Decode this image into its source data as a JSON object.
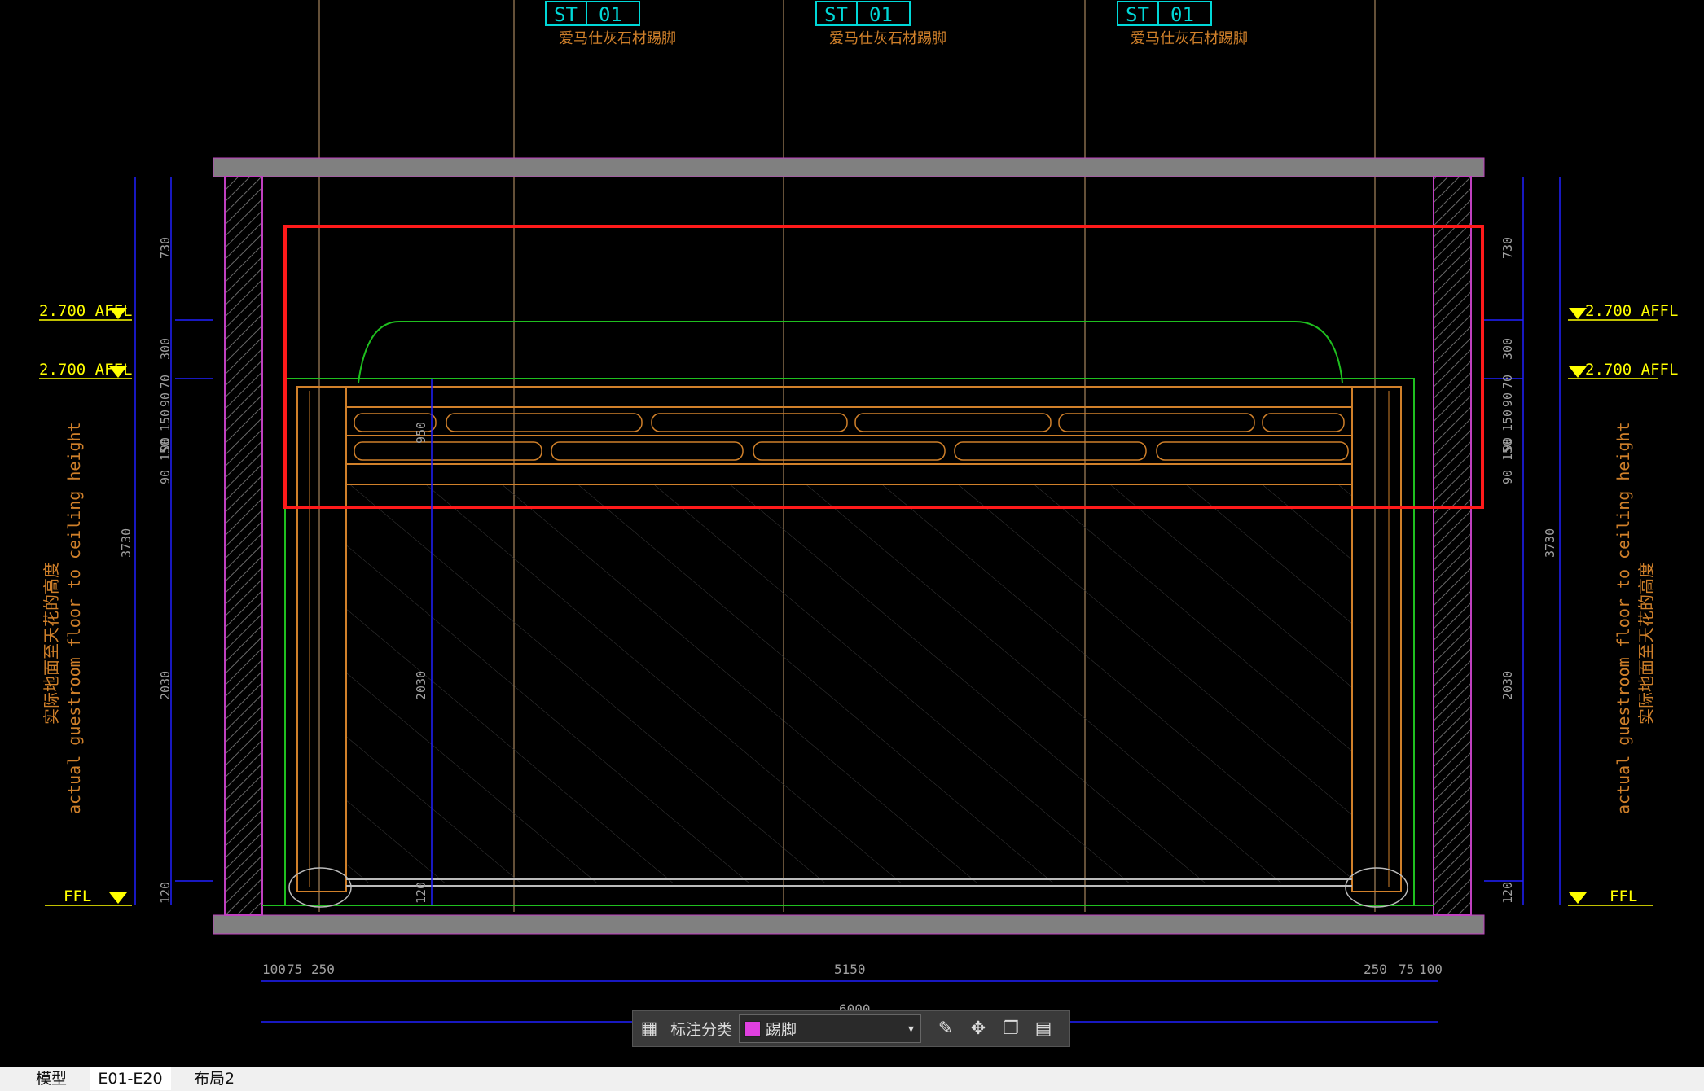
{
  "drawing": {
    "material_tags": [
      {
        "code": "ST",
        "num": "01",
        "desc": "爱马仕灰石材踢脚"
      },
      {
        "code": "ST",
        "num": "01",
        "desc": "爱马仕灰石材踢脚"
      },
      {
        "code": "ST",
        "num": "01",
        "desc": "爱马仕灰石材踢脚"
      }
    ],
    "levels": {
      "affl_upper": "2.700 AFFL",
      "affl_lower": "2.700 AFFL",
      "ffl": "FFL"
    },
    "height_note_cn": "实际地面至天花的高度",
    "height_note_en": "actual guestroom floor to ceiling height",
    "left_dims_inner": [
      "730",
      "300",
      "70",
      "90",
      "150",
      "90",
      "150",
      "90",
      "2030",
      "120"
    ],
    "left_dims_total": "3730",
    "right_dims_inner": [
      "730",
      "300",
      "70",
      "90",
      "150",
      "90",
      "150",
      "90",
      "2030",
      "120"
    ],
    "right_dims_total": "3730",
    "door_dims": [
      "950",
      "2030",
      "120"
    ],
    "bottom_dims": [
      "100",
      "75",
      "250",
      "5150",
      "250",
      "75",
      "100"
    ],
    "bottom_total": "6000",
    "colors": {
      "wall": "#c040c0",
      "slab": "#808080",
      "dimension": "#2020ff",
      "wood": "#d0802a",
      "trim": "#1fbf1f",
      "highlight": "#ff1a1a",
      "level": "#ffff00",
      "tag": "#00d8d8"
    }
  },
  "toolbar": {
    "grid_icon": "grid-icon",
    "label": "标注分类",
    "category_value": "踢脚",
    "category_color": "#e040e0",
    "edit_icon": "edit-icon",
    "move_icon": "move-icon",
    "copy_icon": "copy-icon",
    "paste_icon": "paste-icon"
  },
  "tabs": [
    {
      "label": "模型",
      "active": false
    },
    {
      "label": "E01-E20",
      "active": true
    },
    {
      "label": "布局2",
      "active": false
    }
  ]
}
